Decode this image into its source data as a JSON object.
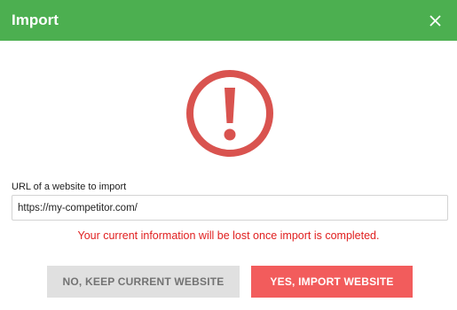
{
  "dialog": {
    "title": "Import",
    "close_icon": "close-icon"
  },
  "warning_icon": {
    "name": "exclamation-circle-icon",
    "color": "#d9534f"
  },
  "form": {
    "url_label": "URL of a website to import",
    "url_value": "https://my-competitor.com/"
  },
  "message": {
    "text": "Your current information will be lost once import is completed.",
    "color": "#e02020"
  },
  "actions": {
    "keep_label": "NO, KEEP CURRENT WEBSITE",
    "import_label": "YES, IMPORT WEBSITE"
  },
  "colors": {
    "header": "#4caf50",
    "import_button": "#f25c5c",
    "keep_button": "#e0e0e0"
  }
}
